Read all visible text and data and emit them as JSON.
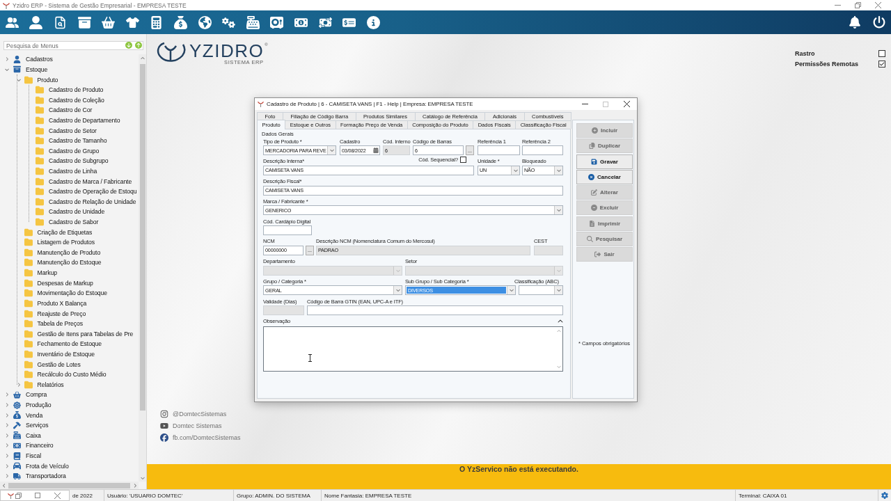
{
  "window": {
    "title": "Yzidro ERP - Sistema de Gestão Empresarial - EMPRESA TESTE"
  },
  "sidebar": {
    "search": {
      "placeholder": "Pesquisa de Menus"
    },
    "tree": [
      {
        "label": "Cadastros",
        "expanded": false
      },
      {
        "label": "Estoque",
        "expanded": true,
        "children": [
          {
            "label": "Produto",
            "expanded": true,
            "children": [
              {
                "label": "Cadastro de Produto"
              },
              {
                "label": "Cadastro de Coleção"
              },
              {
                "label": "Cadastro de Cor"
              },
              {
                "label": "Cadastro de Departamento"
              },
              {
                "label": "Cadastro de Setor"
              },
              {
                "label": "Cadastro de Tamanho"
              },
              {
                "label": "Cadastro de Grupo"
              },
              {
                "label": "Cadastro de Subgrupo"
              },
              {
                "label": "Cadastro de Linha"
              },
              {
                "label": "Cadastro de Marca / Fabricante"
              },
              {
                "label": "Cadastro de Operação de Estoqu"
              },
              {
                "label": "Cadastro de Relação de Unidade"
              },
              {
                "label": "Cadastro de Unidade"
              },
              {
                "label": "Cadastro de Sabor"
              }
            ]
          },
          {
            "label": "Criação de Etiquetas"
          },
          {
            "label": "Listagem de Produtos"
          },
          {
            "label": "Manutenção de Produto"
          },
          {
            "label": "Manutenção do Estoque"
          },
          {
            "label": "Markup"
          },
          {
            "label": "Despesas de Markup"
          },
          {
            "label": "Movimentação do Estoque"
          },
          {
            "label": "Produto X Balança"
          },
          {
            "label": "Reajuste de Preço"
          },
          {
            "label": "Tabela de Preços"
          },
          {
            "label": "Gestão de Itens para Tabelas de Pre"
          },
          {
            "label": "Fechamento de Estoque"
          },
          {
            "label": "Inventário de Estoque"
          },
          {
            "label": "Gestão de Lotes"
          },
          {
            "label": "Recálculo do Custo Médio"
          },
          {
            "label": "Relatórios",
            "expanded": false
          }
        ]
      },
      {
        "label": "Compra",
        "expanded": false
      },
      {
        "label": "Produção",
        "expanded": false
      },
      {
        "label": "Venda",
        "expanded": false
      },
      {
        "label": "Serviços",
        "expanded": false
      },
      {
        "label": "Caixa",
        "expanded": false
      },
      {
        "label": "Financeiro",
        "expanded": false
      },
      {
        "label": "Fiscal",
        "expanded": false
      },
      {
        "label": "Frota de Veículo",
        "expanded": false
      },
      {
        "label": "Transportadora",
        "expanded": false
      }
    ]
  },
  "logo": {
    "name": "YZIDRO",
    "registered": "®",
    "tagline": "SISTEMA ERP"
  },
  "options": [
    {
      "label": "Rastro",
      "checked": false
    },
    {
      "label": "Permissões Remotas",
      "checked": true
    }
  ],
  "dialog": {
    "title": "Cadastro de Produto | 6 - CAMISETA VANS | F1 - Help | Empresa: EMPRESA TESTE",
    "tab_rows": [
      [
        {
          "label": "Foto",
          "selected": false
        },
        {
          "label": "Filiação de Código Barra",
          "selected": false
        },
        {
          "label": "Produtos Similares",
          "selected": false
        },
        {
          "label": "Catálogo de Referência",
          "selected": false
        },
        {
          "label": "Adicionais",
          "selected": false
        },
        {
          "label": "Combustíveis",
          "selected": false
        }
      ],
      [
        {
          "label": "Produto",
          "selected": true
        },
        {
          "label": "Estoque e Outros",
          "selected": false
        },
        {
          "label": "Formação Preço de Venda",
          "selected": false
        },
        {
          "label": "Composição do Produto",
          "selected": false
        },
        {
          "label": "Dados Fiscais",
          "selected": false
        },
        {
          "label": "Classificação Fiscal",
          "selected": false
        }
      ]
    ],
    "group_title": "Dados Gerais",
    "fields": [
      {
        "kind": "select",
        "label": "Tipo de Produto *",
        "value": "MERCADORIA PARA REVE",
        "disabled": false,
        "focused": false
      },
      {
        "kind": "date",
        "label": "Cadastro",
        "value": "03/08/2022",
        "disabled": false,
        "focused": false
      },
      {
        "kind": "text",
        "label": "Cód. Interno",
        "value": "6",
        "disabled": true,
        "focused": false
      },
      {
        "kind": "text",
        "label": "Código de Barras",
        "value": "6",
        "button": "...",
        "disabled": false,
        "focused": false
      },
      {
        "kind": "text",
        "label": "Referência 1",
        "disabled": false,
        "focused": false
      },
      {
        "kind": "text",
        "label": "Referência 2",
        "disabled": false,
        "focused": false
      },
      {
        "kind": "text",
        "label": "Descrição Interna*",
        "value": "CAMISETA VANS",
        "option": {
          "label": "Cód. Sequencial?",
          "checked": false
        },
        "disabled": false,
        "focused": false
      },
      {
        "kind": "select",
        "label": "Unidade *",
        "value": "UN",
        "disabled": false,
        "focused": false
      },
      {
        "kind": "select",
        "label": "Bloqueado",
        "value": "NÃO",
        "disabled": false,
        "focused": false
      },
      {
        "kind": "text",
        "label": "Descrição Fiscal*",
        "value": "CAMISETA VANS",
        "disabled": false,
        "focused": false
      },
      {
        "kind": "select",
        "label": "Marca / Fabricante *",
        "value": "GENERICO",
        "disabled": false,
        "focused": false
      },
      {
        "kind": "text",
        "label": "Cód. Cardápio Digital",
        "disabled": false,
        "focused": false
      },
      {
        "kind": "text",
        "label": "NCM",
        "value": "00000000",
        "button": "...",
        "disabled": false,
        "focused": false
      },
      {
        "kind": "text",
        "label": "Descrição NCM (Nomenclatura Comum do Mercosul)",
        "value": "PADRAO",
        "disabled": true,
        "focused": false
      },
      {
        "kind": "text",
        "label": "CEST",
        "disabled": true,
        "focused": false
      },
      {
        "kind": "select",
        "label": "Departamento",
        "disabled": true,
        "focused": false
      },
      {
        "kind": "select",
        "label": "Setor",
        "disabled": true,
        "focused": false
      },
      {
        "kind": "select",
        "label": "Grupo / Categoria *",
        "value": "GERAL",
        "disabled": false,
        "focused": false
      },
      {
        "kind": "select",
        "label": "Sub Grupo / Sub Categoria *",
        "value": "DIVERSOS",
        "disabled": false,
        "focused": true
      },
      {
        "kind": "select",
        "label": "Classificação (ABC)",
        "disabled": false,
        "focused": false
      },
      {
        "kind": "text",
        "label": "Validade (Dias)",
        "disabled": true,
        "focused": false
      },
      {
        "kind": "text",
        "label": "Código de Barra GTIN (EAN, UPC-A e ITF)",
        "disabled": false,
        "focused": false
      }
    ],
    "observation": {
      "label": "Observação",
      "expanded": true
    },
    "buttons": [
      {
        "label": "Incluir",
        "disabled": true
      },
      {
        "label": "Duplicar",
        "disabled": true
      },
      {
        "label": "Gravar",
        "disabled": false
      },
      {
        "label": "Cancelar",
        "disabled": false
      },
      {
        "label": "Alterar",
        "disabled": true
      },
      {
        "label": "Excluir",
        "disabled": true
      },
      {
        "label": "Imprimir",
        "disabled": true
      },
      {
        "label": "Pesquisar",
        "disabled": true
      },
      {
        "label": "Sair",
        "disabled": true
      }
    ],
    "note": "* Campos obrigatórios"
  },
  "social": [
    "@DomtecSistemas",
    "Domtec Sistemas",
    "fb.com/DomtecSistemas"
  ],
  "service_banner": "O YzServico não está executando.",
  "status_bar": [
    "de 2022",
    "Usuário: 'USUARIO DOMTEC'",
    "Grupo: ADMIN. DO SISTEMA",
    "Nome Fantasia: EMPRESA TESTE",
    "Terminal: CAIXA 01"
  ]
}
